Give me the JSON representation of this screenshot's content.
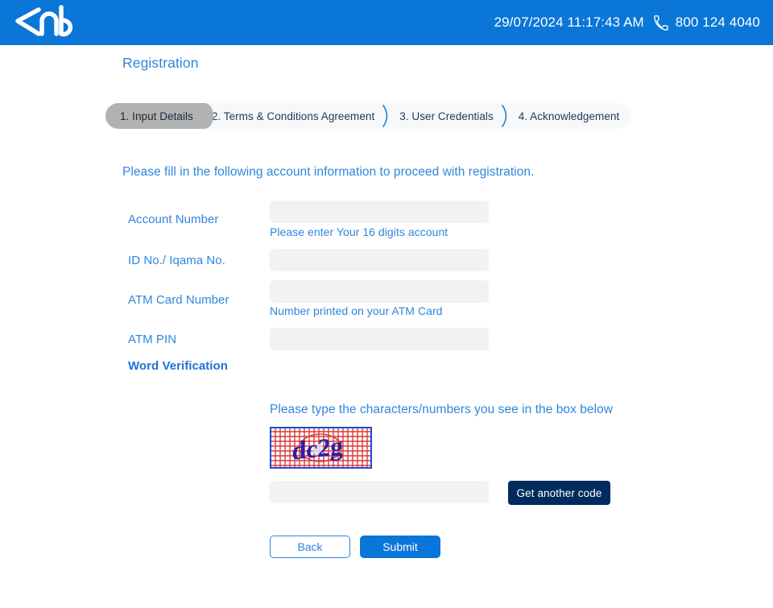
{
  "header": {
    "logo_text": "anb",
    "logo_icon": "anb-logo",
    "datetime": "29/07/2024 11:17:43 AM",
    "phone_icon": "phone-icon",
    "phone": "800 124 4040",
    "bg_color": "#0a76d8"
  },
  "page": {
    "title": "Registration",
    "intro": "Please fill in the following account information to proceed with registration.",
    "accent_color": "#2e86de"
  },
  "steps": [
    {
      "label": "1. Input Details",
      "active": true
    },
    {
      "label": "2. Terms & Conditions Agreement",
      "active": false
    },
    {
      "label": "3. User Credentials",
      "active": false
    },
    {
      "label": "4. Acknowledgement",
      "active": false
    }
  ],
  "fields": [
    {
      "label": "Account Number",
      "value": "",
      "placeholder": "",
      "hint": "Please enter Your 16 digits account"
    },
    {
      "label": "ID No./ Iqama No.",
      "value": "",
      "placeholder": "",
      "hint": ""
    },
    {
      "label": "ATM Card Number",
      "value": "",
      "placeholder": "",
      "hint": "Number printed on your ATM Card"
    },
    {
      "label": "ATM PIN",
      "value": "",
      "placeholder": "",
      "hint": ""
    }
  ],
  "word_verification": {
    "label": "Word Verification",
    "instruction": "Please type the characters/numbers you see in the box below",
    "captcha_text": "dc2g",
    "captcha_icon": "captcha-image",
    "captcha_border_color": "#1a4ed8",
    "captcha_grid_color": "#d93a3a",
    "captcha_text_color": "#2a1fa8",
    "input_value": "",
    "input_placeholder": "",
    "refresh_label": "Get another code",
    "refresh_bg_color": "#002b5c"
  },
  "actions": {
    "back_label": "Back",
    "submit_label": "Submit",
    "submit_bg_color": "#0a76d8"
  }
}
